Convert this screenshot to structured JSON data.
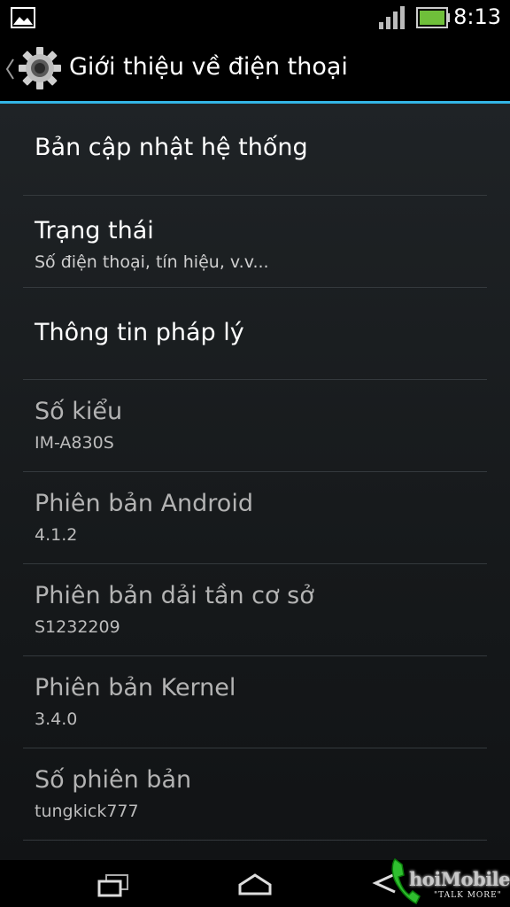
{
  "status_bar": {
    "time": "8:13",
    "icons": [
      "gallery-notification-icon",
      "signal-icon",
      "battery-icon"
    ]
  },
  "action_bar": {
    "title": "Giới thiệu về điện thoại",
    "icon": "settings-gear-icon",
    "accent_color": "#33b5e5"
  },
  "items": [
    {
      "title": "Bản cập nhật hệ thống",
      "summary": ""
    },
    {
      "title": "Trạng thái",
      "summary": "Số điện thoại, tín hiệu, v.v..."
    },
    {
      "title": "Thông tin pháp lý",
      "summary": ""
    },
    {
      "title": "Số kiểu",
      "summary": "IM-A830S"
    },
    {
      "title": "Phiên bản Android",
      "summary": "4.1.2"
    },
    {
      "title": "Phiên bản dải tần cơ sở",
      "summary": "S1232209"
    },
    {
      "title": "Phiên bản Kernel",
      "summary": "3.4.0"
    },
    {
      "title": "Số phiên bản",
      "summary": "tungkick777"
    }
  ],
  "nav_bar": {
    "icons": [
      "recent-apps-icon",
      "home-icon",
      "back-icon"
    ]
  },
  "watermark": {
    "text": "hoiMobile",
    "slogan": "\"TALK MORE\""
  }
}
